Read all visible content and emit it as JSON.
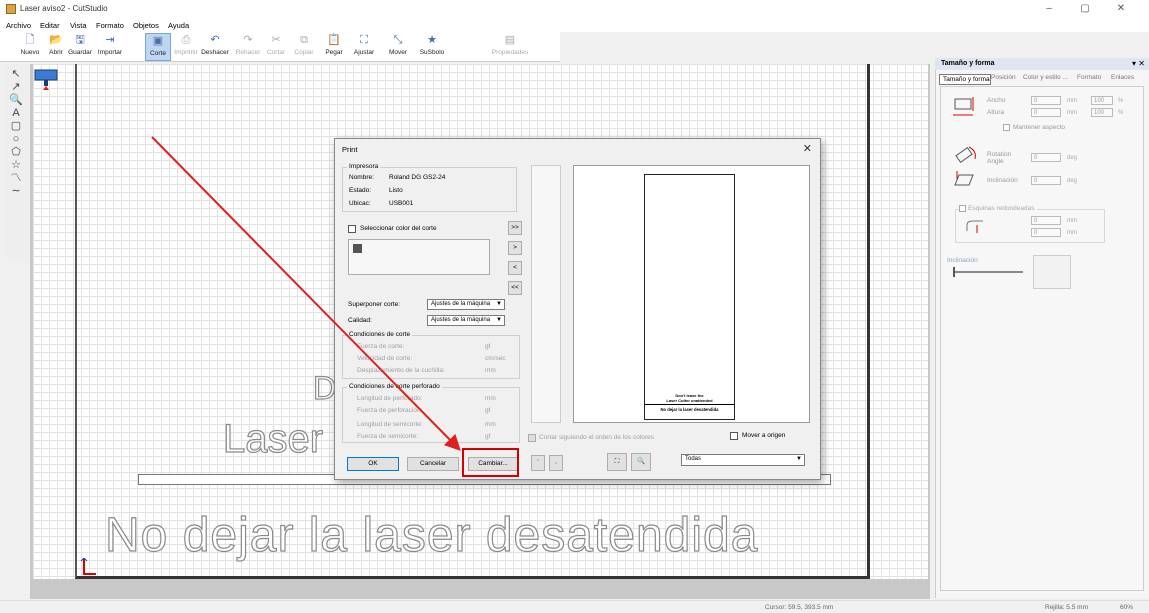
{
  "window": {
    "title": "Laser aviso2 - CutStudio",
    "minimize": "–",
    "maximize": "▢",
    "close": "✕"
  },
  "menu": [
    "Archivo",
    "Editar",
    "Vista",
    "Formato",
    "Objetos",
    "Ayuda"
  ],
  "toolbar": [
    {
      "label": "Nuevo",
      "icon": "new-icon",
      "glyph": "🗋",
      "enabled": true
    },
    {
      "label": "Abrir",
      "icon": "open-folder-icon",
      "glyph": "📂",
      "enabled": true
    },
    {
      "label": "Guardar",
      "icon": "save-icon",
      "glyph": "🖫",
      "enabled": true
    },
    {
      "label": "Importar",
      "icon": "import-icon",
      "glyph": "⇥",
      "enabled": true
    },
    {
      "label": "Corte",
      "icon": "cut-machine-icon",
      "glyph": "▣",
      "enabled": true,
      "active": true
    },
    {
      "label": "Imprimir",
      "icon": "print-icon",
      "glyph": "⎙",
      "enabled": false
    },
    {
      "label": "Deshacer",
      "icon": "undo-icon",
      "glyph": "↶",
      "enabled": true
    },
    {
      "label": "Rehacer",
      "icon": "redo-icon",
      "glyph": "↷",
      "enabled": false
    },
    {
      "label": "Cortar",
      "icon": "cut-icon",
      "glyph": "✂",
      "enabled": false
    },
    {
      "label": "Copiar",
      "icon": "copy-icon",
      "glyph": "⧉",
      "enabled": false
    },
    {
      "label": "Pegar",
      "icon": "paste-icon",
      "glyph": "📋",
      "enabled": true
    },
    {
      "label": "Ajustar",
      "icon": "fit-icon",
      "glyph": "⛶",
      "enabled": true
    },
    {
      "label": "Mover",
      "icon": "move-icon",
      "glyph": "⤡",
      "enabled": true
    },
    {
      "label": "SuSbolo",
      "icon": "star-icon",
      "glyph": "★",
      "enabled": true
    },
    {
      "label": "Propiedades",
      "icon": "properties-icon",
      "glyph": "▤",
      "enabled": false
    }
  ],
  "lefttools": [
    {
      "name": "select-tool-icon",
      "glyph": "↖"
    },
    {
      "name": "node-edit-tool-icon",
      "glyph": "↗"
    },
    {
      "name": "zoom-tool-icon",
      "glyph": "🔍"
    },
    {
      "name": "text-tool-icon",
      "glyph": "A"
    },
    {
      "name": "rectangle-tool-icon",
      "glyph": "▢"
    },
    {
      "name": "ellipse-tool-icon",
      "glyph": "○"
    },
    {
      "name": "polygon-tool-icon",
      "glyph": "⬠"
    },
    {
      "name": "star-tool-icon",
      "glyph": "☆"
    },
    {
      "name": "polyline-tool-icon",
      "glyph": "〽"
    },
    {
      "name": "curve-tool-icon",
      "glyph": "∼"
    }
  ],
  "canvas": {
    "big_text": "No dejar la laser desatendida",
    "laser_text": "Laser",
    "d_text": "D"
  },
  "panel": {
    "title": "Tamaño y forma",
    "close": "▾ ✕",
    "tabs": [
      "Tamaño y forma",
      "Posición",
      "Color y estilo ...",
      "Formato",
      "Enlaces"
    ],
    "ancho_label": "Ancho",
    "altura_label": "Altura",
    "ancho_value": "0",
    "altura_value": "0",
    "unit_mm": "mm",
    "pct_ancho": "100",
    "pct_altura": "100",
    "pct": "%",
    "mantener": "Mantener aspecto",
    "rotation_label": "Rotation Angle",
    "rotation_value": "0",
    "deg": "deg",
    "inclinacion_label": "Inclinación",
    "inclinacion_value": "0",
    "esquinas": "Esquinas redondeadas",
    "esq1": "0",
    "esq2": "0",
    "inclinacion2": "Inclinación"
  },
  "status": {
    "cursor": "Cursor: 59.5, 393.5 mm",
    "rejilla": "Rejilla: 5.5 mm",
    "zoom": "60%"
  },
  "dialog": {
    "title": "Print",
    "close": "✕",
    "impresora_group": "Impresora",
    "nombre_label": "Nombre:",
    "nombre_value": "Roland DG GS2-24",
    "estado_label": "Estado:",
    "estado_value": "Listo",
    "ubicac_label": "Ubicac:",
    "ubicac_value": "USB001",
    "seleccionar_color": "Seleccionar color del corte",
    "btn_all_right": ">>",
    "btn_right": ">",
    "btn_left": "<",
    "btn_all_left": "<<",
    "superponer_label": "Superponer corte:",
    "superponer_value": "Ajustes de la máquina",
    "calidad_label": "Calidad:",
    "calidad_value": "Ajustes de la máquina",
    "cond_corte_group": "Condiciones de corte",
    "fuerza_corte": "Fuerza de corte:",
    "fuerza_corte_unit": "gf",
    "velocidad_corte": "Velocidad de corte:",
    "velocidad_unit": "cm/sec",
    "desplazamiento": "Desplazamiento de la cuchilla:",
    "desplazamiento_unit": "mm",
    "cond_perforado_group": "Condiciones de corte perforado",
    "longitud_perforado": "Longitud de perforado:",
    "longitud_perforado_unit": "mm",
    "fuerza_perforacion": "Fuerza de perforación:",
    "fuerza_perforacion_unit": "gf",
    "longitud_semicorte": "Longitud de semicorte:",
    "longitud_semicorte_unit": "mm",
    "fuerza_semicorte": "Fuerza de semicorte:",
    "fuerza_semicorte_unit": "gf",
    "ok": "OK",
    "cancelar": "Cancelar",
    "cambiar": "Cambiar...",
    "cortar_orden": "Cortar siguiendo el orden de los colores",
    "mover_origen": "Mover a origen",
    "todas": "Todas",
    "preview_line1": "Don't leave the",
    "preview_line2": "Laser Cutter unattended",
    "preview_line3": "No dejar la laser desatendida"
  }
}
